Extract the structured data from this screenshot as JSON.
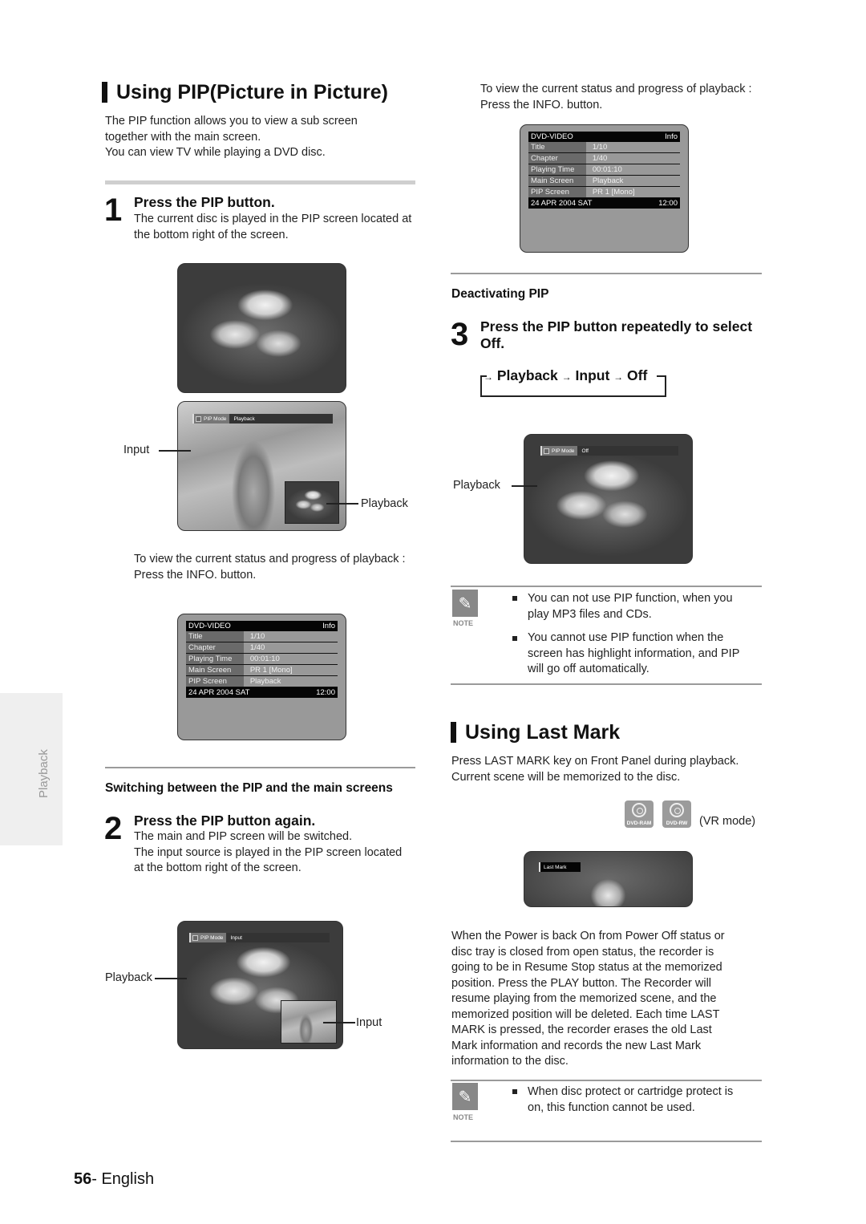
{
  "page": {
    "number": "56",
    "language": "- English",
    "side_tab": "Playback"
  },
  "pip_section": {
    "title": "Using PIP(Picture in Picture)",
    "intro": [
      "The PIP function allows you to view a sub screen",
      "together with the main screen.",
      "You can view TV while playing a DVD disc."
    ],
    "step1": {
      "number": "1",
      "title": "Press the PIP button.",
      "body": [
        "The current disc is played in the PIP screen located at",
        "the bottom right of the screen."
      ]
    },
    "screen1": {
      "osd_label": "PIP Mode",
      "osd_value": "Playback",
      "callout_left": "Input",
      "callout_right": "Playback"
    },
    "info_text": [
      "To view the current status and progress of playback :",
      "Press the INFO. button."
    ],
    "info_screen_left": {
      "header_left": "DVD-VIDEO",
      "header_right": "Info",
      "rows": [
        {
          "key": "Title",
          "value": "1/10"
        },
        {
          "key": "Chapter",
          "value": "1/40"
        },
        {
          "key": "Playing Time",
          "value": "00:01:10"
        },
        {
          "key": "Main Screen",
          "value": "PR 1 [Mono]"
        },
        {
          "key": "PIP Screen",
          "value": "Playback"
        }
      ],
      "footer_left": "24 APR 2004 SAT",
      "footer_right": "12:00"
    },
    "switching_heading": "Switching between the PIP and the main screens",
    "step2": {
      "number": "2",
      "title": "Press the PIP button again.",
      "body": [
        "The main and PIP screen will be switched.",
        "The input source is played in the PIP screen located",
        "at the bottom right of the screen."
      ]
    },
    "screen2": {
      "osd_label": "PIP Mode",
      "osd_value": "Input",
      "callout_left": "Playback",
      "callout_right": "Input"
    }
  },
  "right_column": {
    "info_text": [
      "To view the current status and progress of playback :",
      "Press the INFO. button."
    ],
    "info_screen_right": {
      "header_left": "DVD-VIDEO",
      "header_right": "Info",
      "rows": [
        {
          "key": "Title",
          "value": "1/10"
        },
        {
          "key": "Chapter",
          "value": "1/40"
        },
        {
          "key": "Playing Time",
          "value": "00:01:10"
        },
        {
          "key": "Main Screen",
          "value": "Playback"
        },
        {
          "key": "PIP Screen",
          "value": "PR 1 [Mono]"
        }
      ],
      "footer_left": "24 APR 2004 SAT",
      "footer_right": "12:00"
    },
    "deactivating_heading": "Deactivating PIP",
    "step3": {
      "number": "3",
      "title": [
        "Press the PIP button repeatedly to select",
        "Off."
      ]
    },
    "cycle": {
      "items": [
        "Playback",
        "Input",
        "Off"
      ],
      "arrow": "→"
    },
    "screen3": {
      "osd_label": "PIP Mode",
      "osd_value": "Off",
      "callout_left": "Playback"
    },
    "note1": {
      "label": "NOTE",
      "items": [
        [
          "You can not use PIP function, when you",
          "play MP3 files and CDs."
        ],
        [
          "You cannot use PIP function when the",
          "screen has highlight information, and PIP",
          "will go off automatically."
        ]
      ]
    }
  },
  "last_mark_section": {
    "title": "Using Last Mark",
    "intro": [
      "Press LAST MARK key on Front Panel during playback.",
      "Current scene will be memorized to the disc."
    ],
    "disc_badges": [
      "DVD-RAM",
      "DVD-RW"
    ],
    "mode_label": "(VR mode)",
    "screen": {
      "osd_label": "Last Mark"
    },
    "body": [
      "When the Power is back On from Power Off status or",
      "disc tray is closed from open status, the recorder is",
      "going to be in Resume Stop status at the memorized",
      "position. Press the PLAY button. The Recorder will",
      "resume playing from the memorized scene, and the",
      "memorized position will be deleted. Each time LAST",
      "MARK is pressed, the recorder erases the old Last",
      "Mark information and records the new Last Mark",
      "information to the disc."
    ],
    "note2": {
      "label": "NOTE",
      "items": [
        [
          "When disc protect or cartridge protect is",
          "on, this function cannot be used."
        ]
      ]
    }
  }
}
